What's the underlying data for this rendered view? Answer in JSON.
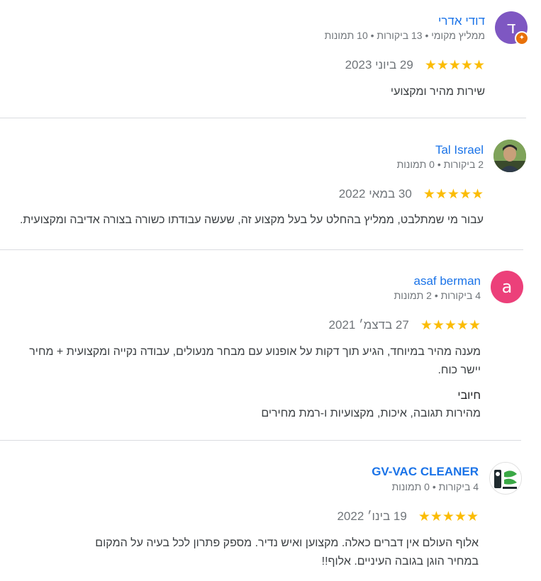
{
  "reviews": [
    {
      "name": "דודי אדרי",
      "avatar_letter": "ד",
      "avatar_color": "#7e57c2",
      "meta": "ממליץ מקומי • 13 ביקורות • 10 תמונות",
      "stars": "★★★★★",
      "rating": 5,
      "date": "29 ביוני 2023",
      "text": "שירות מהיר ומקצועי"
    },
    {
      "name": "Tal Israel",
      "meta": "2 ביקורות • 0 תמונות",
      "stars": "★★★★★",
      "rating": 5,
      "date": "30 במאי 2022",
      "text": "עבור מי שמתלבט, ממליץ בהחלט על בעל מקצוע זה, שעשה עבודתו כשורה בצורה אדיבה ומקצועית."
    },
    {
      "name": "asaf berman",
      "avatar_letter": "a",
      "avatar_color": "#ec407a",
      "meta": "4 ביקורות • 2 תמונות",
      "stars": "★★★★★",
      "rating": 5,
      "date": "27 בדצמ׳ 2021",
      "text_line1": "מענה מהיר במיוחד, הגיע תוך דקות על אופנוע עם מבחר מנעולים, עבודה נקייה ומקצועית + מחיר",
      "text_line2": "יישר כוח.",
      "positive_label": "חיובי",
      "positive_text": "מהירות תגובה, איכות, מקצועיות ו-רמת מחירים"
    },
    {
      "name": "GV-VAC CLEANER",
      "meta": "4 ביקורות • 0 תמונות",
      "stars": "★★★★★",
      "rating": 5,
      "date": "19 בינו׳ 2022",
      "text_line1": "אלוף העולם אין דברים כאלה. מקצוען ואיש נדיר. מספק פתרון לכל בעיה על המקום",
      "text_line2": "במחיר הוגן בגובה העיניים. אלוף!!"
    }
  ]
}
